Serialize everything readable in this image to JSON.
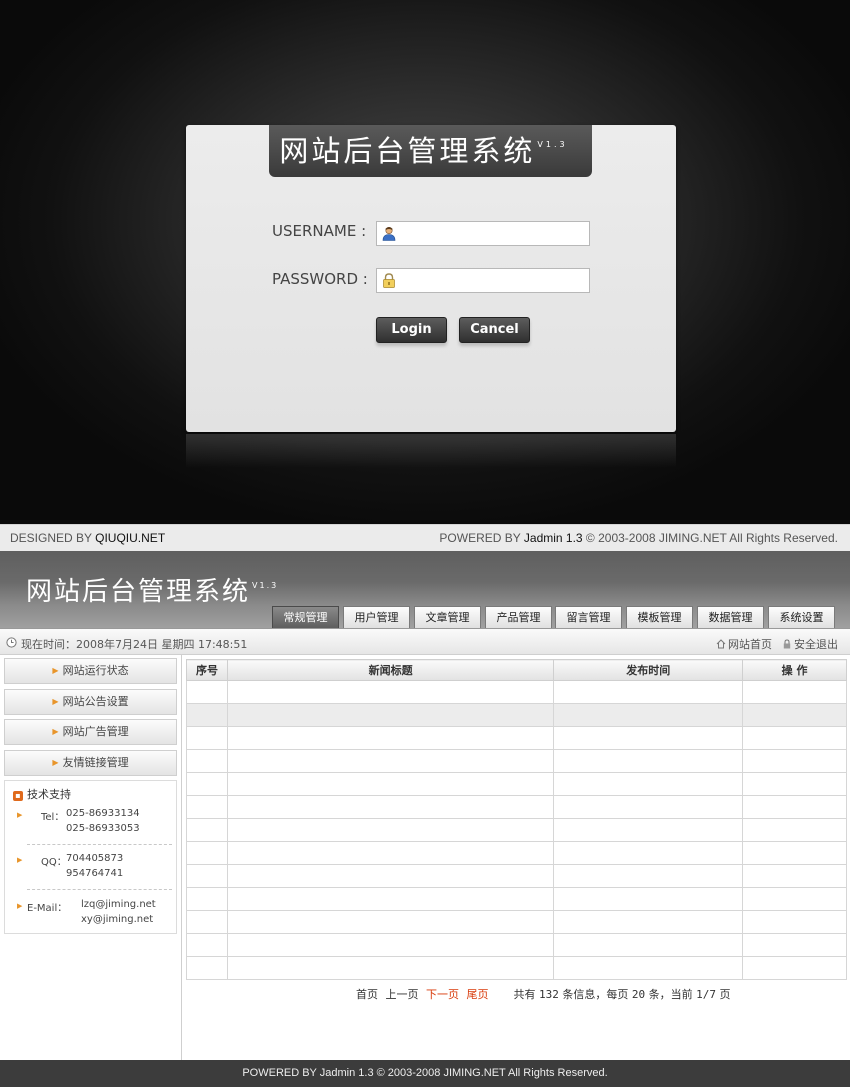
{
  "login": {
    "title": "网站后台管理系统",
    "version": "V1.3",
    "username_label": "USERNAME :",
    "password_label": "PASSWORD :",
    "username_value": "",
    "password_value": "",
    "login_button": "Login",
    "cancel_button": "Cancel"
  },
  "credit_bar": {
    "designed_prefix": "DESIGNED BY ",
    "designed_by": "QIUQIU.NET",
    "powered_prefix": "POWERED BY ",
    "powered_by": "Jadmin 1.3",
    "powered_suffix": " © 2003-2008 JIMING.NET All Rights Reserved."
  },
  "header": {
    "title": "网站后台管理系统",
    "version": "V1.3",
    "tabs": [
      "常规管理",
      "用户管理",
      "文章管理",
      "产品管理",
      "留言管理",
      "模板管理",
      "数据管理",
      "系统设置"
    ],
    "active_tab": "常规管理"
  },
  "status_bar": {
    "time_text": "现在时间：2008年7月24日 星期四 17:48:51",
    "home_link": "网站首页",
    "logout_link": "安全退出"
  },
  "sidebar": {
    "items": [
      "网站运行状态",
      "网站公告设置",
      "网站广告管理",
      "友情链接管理"
    ],
    "support": {
      "title": "技术支持",
      "tel_label": "Tel：",
      "tel": [
        "025-86933134",
        "025-86933053"
      ],
      "qq_label": "QQ：",
      "qq": [
        "704405873",
        "954764741"
      ],
      "email_label": "E-Mail：",
      "email": [
        "lzq@jiming.net",
        "xy@jiming.net"
      ]
    }
  },
  "table": {
    "columns": [
      "序号",
      "新闻标题",
      "发布时间",
      "操  作"
    ],
    "row_count": 13
  },
  "pagination": {
    "first": "首页",
    "prev": "上一页",
    "next": "下一页",
    "last": "尾页",
    "total_prefix": "共有",
    "total": "132",
    "total_suffix": "条信息，每页",
    "per_page": "20",
    "per_page_suffix": "条，当前",
    "current": "1/7",
    "page_suffix": "页"
  },
  "footer": {
    "text": "POWERED BY Jadmin 1.3 © 2003-2008 JIMING.NET All Rights Reserved."
  },
  "colors": {
    "accent_orange": "#e8952b",
    "link_red": "#d83a0a",
    "footer_bg": "#3c3c3c"
  },
  "icons": [
    "user-icon",
    "lock-icon",
    "clock-icon",
    "home-icon",
    "logout-lock-icon",
    "triangle-right-icon",
    "support-badge-icon"
  ]
}
